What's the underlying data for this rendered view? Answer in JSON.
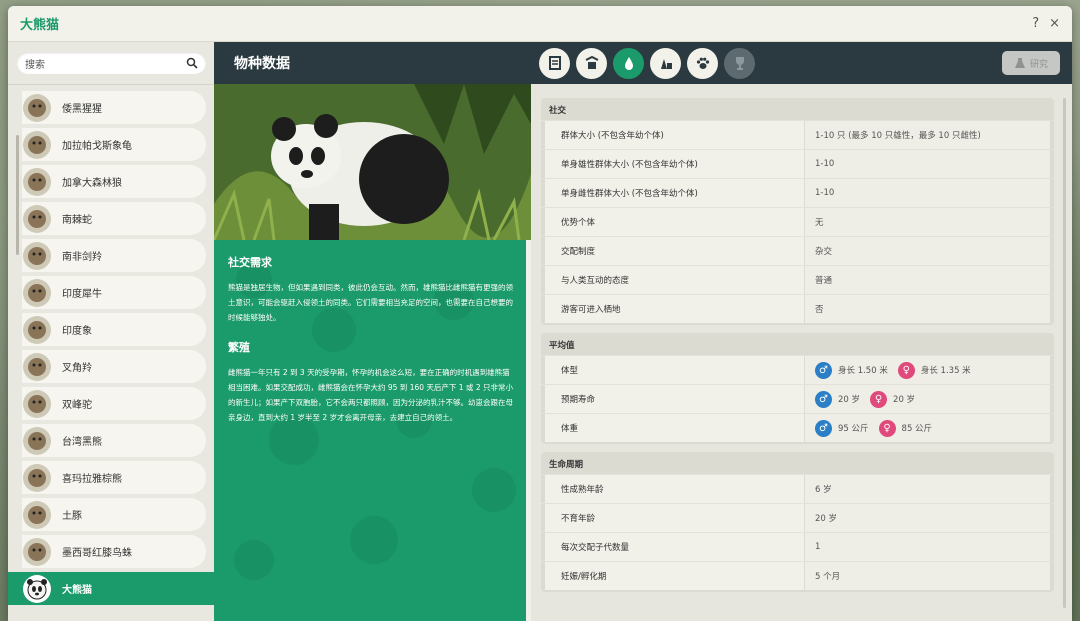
{
  "window": {
    "title": "大熊猫",
    "help": "?",
    "close": "×"
  },
  "search": {
    "placeholder": "搜索"
  },
  "species": [
    {
      "name": "倭黑猩猩"
    },
    {
      "name": "加拉帕戈斯象龟"
    },
    {
      "name": "加拿大森林狼"
    },
    {
      "name": "南棘蛇"
    },
    {
      "name": "南非剑羚"
    },
    {
      "name": "印度犀牛"
    },
    {
      "name": "印度象"
    },
    {
      "name": "叉角羚"
    },
    {
      "name": "双峰驼"
    },
    {
      "name": "台湾黑熊"
    },
    {
      "name": "喜玛拉雅棕熊"
    },
    {
      "name": "土豚"
    },
    {
      "name": "墨西哥红膝鸟蛛"
    },
    {
      "name": "大熊猫",
      "active": true
    }
  ],
  "header": {
    "title": "物种数据",
    "research": "研究"
  },
  "tabs": [
    {
      "icon": "book-icon"
    },
    {
      "icon": "habitat-icon"
    },
    {
      "icon": "water-drop-icon",
      "active": true
    },
    {
      "icon": "enrichment-icon"
    },
    {
      "icon": "paw-icon"
    },
    {
      "icon": "trophy-icon",
      "disabled": true
    }
  ],
  "info": {
    "social_title": "社交需求",
    "social_text": "熊猫是独居生物，但如果遇到同类，彼此仍会互动。然而，雄熊猫比雌熊猫有更强的领土意识，可能会驱赶入侵领土的同类。它们需要相当充足的空间，也需要在自己想要的时候能够独处。",
    "breeding_title": "繁殖",
    "breeding_text": "雌熊猫一年只有 2 到 3 天的受孕期，怀孕的机会这么短，要在正确的时机遇到雄熊猫相当困难。如果交配成功，雌熊猫会在怀孕大约 95 到 160 天后产下 1 或 2 只非常小的新生儿；如果产下双胞胎，它不会两只都照顾，因为分泌的乳汁不够。幼崽会跟在母亲身边，直到大约 1 岁半至 2 岁才会离开母亲，去建立自己的领土。"
  },
  "sections": {
    "social": {
      "title": "社交",
      "rows": [
        {
          "label": "群体大小 (不包含年幼个体)",
          "value": "1-10 只 (最多 10 只雄性，最多 10 只雌性)"
        },
        {
          "label": "单身雄性群体大小 (不包含年幼个体)",
          "value": "1-10"
        },
        {
          "label": "单身雌性群体大小 (不包含年幼个体)",
          "value": "1-10"
        },
        {
          "label": "优势个体",
          "value": "无"
        },
        {
          "label": "交配制度",
          "value": "杂交"
        },
        {
          "label": "与人类互动的态度",
          "value": "普通"
        },
        {
          "label": "游客可进入栖地",
          "value": "否"
        }
      ]
    },
    "average": {
      "title": "平均值",
      "rows": [
        {
          "label": "体型",
          "male": "身长 1.50 米",
          "female": "身长 1.35 米"
        },
        {
          "label": "预期寿命",
          "male": "20 岁",
          "female": "20 岁"
        },
        {
          "label": "体重",
          "male": "95 公斤",
          "female": "85 公斤"
        }
      ]
    },
    "life": {
      "title": "生命周期",
      "rows": [
        {
          "label": "性成熟年龄",
          "value": "6 岁"
        },
        {
          "label": "不育年龄",
          "value": "20 岁"
        },
        {
          "label": "每次交配子代数量",
          "value": "1"
        },
        {
          "label": "妊娠/孵化期",
          "value": "5 个月"
        }
      ]
    }
  },
  "colors": {
    "accent": "#1b9a6b",
    "header": "#2b3a40",
    "male": "#2b7fc6",
    "female": "#e0497c"
  }
}
